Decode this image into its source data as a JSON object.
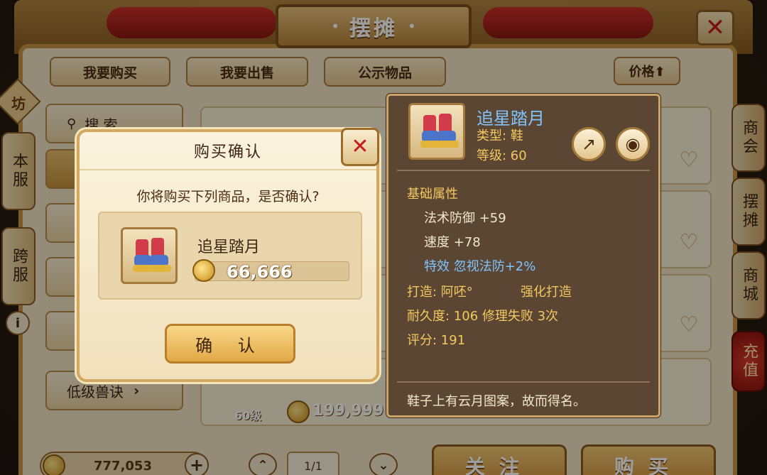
{
  "window": {
    "title": "摆摊",
    "close_label": "✕"
  },
  "tabs": [
    {
      "label": "我要购买"
    },
    {
      "label": "我要出售"
    },
    {
      "label": "公示物品"
    }
  ],
  "sort": {
    "label": "价格⬆"
  },
  "left_side": {
    "badge": "坊",
    "tags": [
      "本服",
      "跨服"
    ],
    "info": "i"
  },
  "right_side": {
    "tags": [
      "商会",
      "摆摊",
      "商城",
      "充值"
    ]
  },
  "categories": {
    "search": "搜 索",
    "last": "低级兽诀"
  },
  "list": {
    "visible_item_level": "60级",
    "visible_item_price": "199,999"
  },
  "footer": {
    "gold_balance": "777,053",
    "plus": "+",
    "page": "1/1",
    "up": "⌃",
    "down": "⌄",
    "follow": "关注",
    "buy": "购买"
  },
  "dialog": {
    "title": "购买确认",
    "question": "你将购买下列商品，是否确认?",
    "item_name": "追星踏月",
    "price": "66,666",
    "confirm": "确 认"
  },
  "tooltip": {
    "name": "追星踏月",
    "type": "类型: 鞋",
    "level": "等级: 60",
    "section": "基础属性",
    "attr1": "法术防御 +59",
    "attr2": "速度 +78",
    "effect": "特效 忽视法防+2%",
    "craft_label": "打造: 阿呸°",
    "craft_extra": "强化打造",
    "durability": "耐久度: 106 修理失败 3次",
    "score": "评分: 191",
    "description": "鞋子上有云月图案，故而得名。"
  },
  "colors": {
    "accent_gold": "#c89446",
    "close_red": "#c21b1b",
    "tooltip_blue": "#7fc4ff",
    "tooltip_bg": "#5b4633"
  }
}
